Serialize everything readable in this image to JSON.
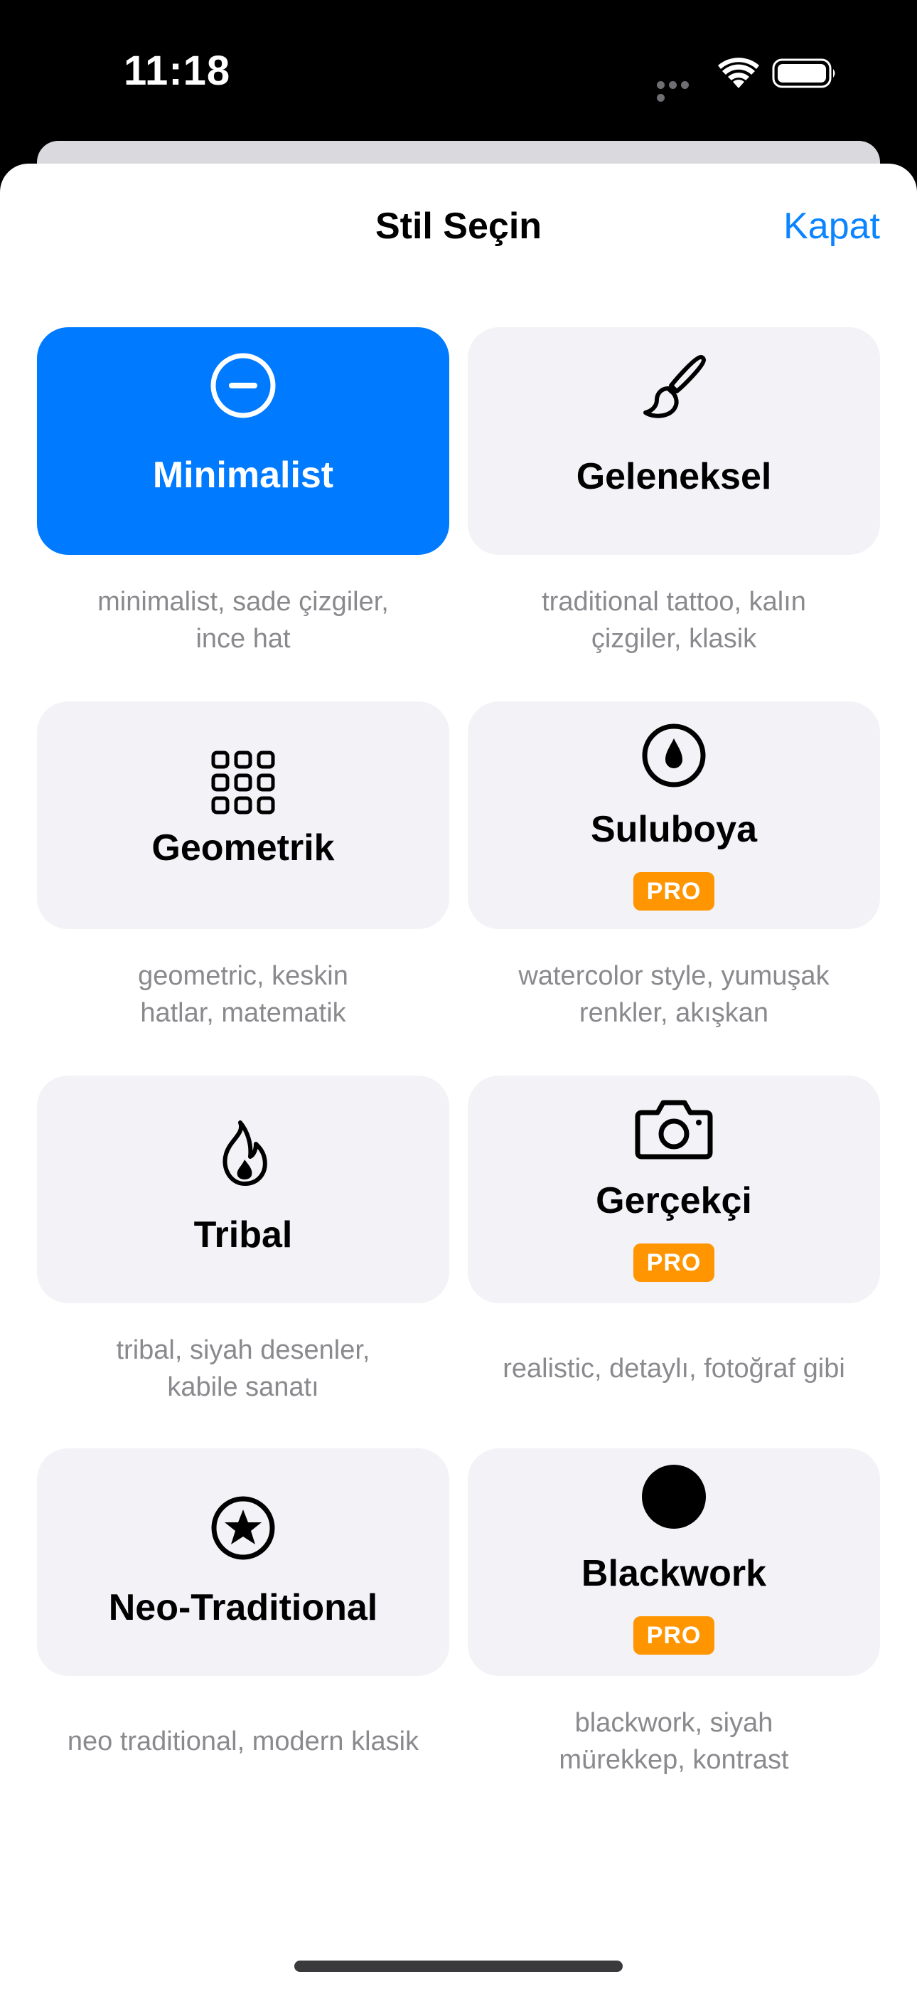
{
  "status_bar": {
    "time": "11:18"
  },
  "sheet": {
    "title": "Stil Seçin",
    "close_label": "Kapat"
  },
  "styles": [
    {
      "label": "Minimalist",
      "icon": "minus-circle-icon",
      "pro": false,
      "selected": true,
      "description_lines": [
        "minimalist, sade çizgiler,",
        "ince hat"
      ]
    },
    {
      "label": "Geleneksel",
      "icon": "paintbrush-icon",
      "pro": false,
      "selected": false,
      "description_lines": [
        "traditional tattoo, kalın",
        "çizgiler, klasik"
      ]
    },
    {
      "label": "Geometrik",
      "icon": "grid-icon",
      "pro": false,
      "selected": false,
      "description_lines": [
        "geometric, keskin",
        "hatlar, matematik"
      ]
    },
    {
      "label": "Suluboya",
      "icon": "drop-circle-icon",
      "pro": true,
      "selected": false,
      "description_lines": [
        "watercolor style, yumuşak",
        "renkler, akışkan"
      ]
    },
    {
      "label": "Tribal",
      "icon": "flame-icon",
      "pro": false,
      "selected": false,
      "description_lines": [
        "tribal, siyah desenler,",
        "kabile sanatı"
      ]
    },
    {
      "label": "Gerçekçi",
      "icon": "camera-icon",
      "pro": true,
      "selected": false,
      "description_lines": [
        "realistic, detaylı, fotoğraf gibi"
      ]
    },
    {
      "label": "Neo-Traditional",
      "icon": "star-circle-icon",
      "pro": false,
      "selected": false,
      "description_lines": [
        "neo traditional, modern klasik"
      ]
    },
    {
      "label": "Blackwork",
      "icon": "filled-circle-icon",
      "pro": true,
      "selected": false,
      "description_lines": [
        "blackwork, siyah",
        "mürekkep, kontrast"
      ]
    }
  ],
  "pro_badge_label": "PRO",
  "colors": {
    "accent": "#007aff",
    "link": "#0a84ff",
    "pro": "#ff9500",
    "card_bg": "#f2f2f7",
    "description": "#8a8a8e"
  }
}
